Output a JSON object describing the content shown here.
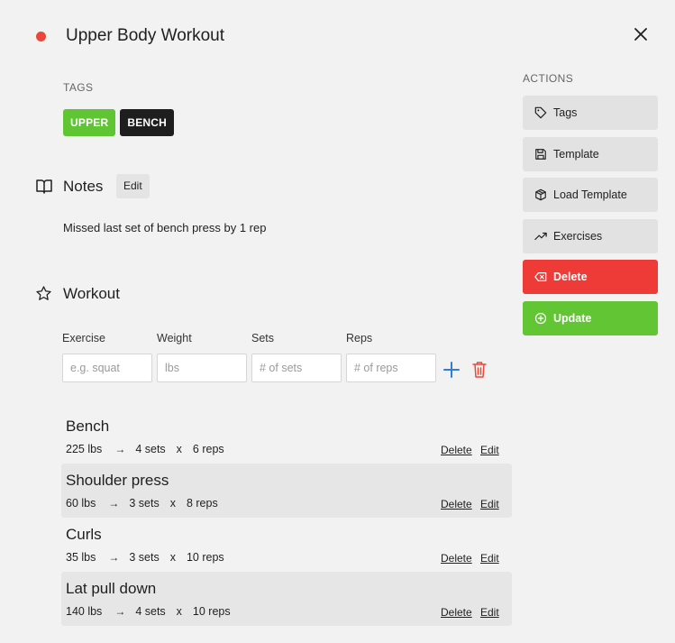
{
  "header": {
    "title": "Upper Body Workout",
    "status_color": "#e8483b"
  },
  "tags": {
    "label": "TAGS",
    "items": [
      {
        "label": "UPPER",
        "color": "#5fc532"
      },
      {
        "label": "BENCH",
        "color": "#1e1e1e"
      }
    ]
  },
  "notes": {
    "heading": "Notes",
    "edit_label": "Edit",
    "text": "Missed last set of bench press by 1 rep",
    "icon": "book-open-icon"
  },
  "workout": {
    "heading": "Workout",
    "icon": "star-icon",
    "form": {
      "exercise_label": "Exercise",
      "exercise_placeholder": "e.g. squat",
      "weight_label": "Weight",
      "weight_placeholder": "lbs",
      "sets_label": "Sets",
      "sets_placeholder": "# of sets",
      "reps_label": "Reps",
      "reps_placeholder": "# of reps"
    },
    "exercises": [
      {
        "name": "Bench",
        "weight": "225 lbs",
        "arrow": "→",
        "sets": "4 sets",
        "x": "x",
        "reps": "6 reps",
        "delete": "Delete",
        "edit": "Edit"
      },
      {
        "name": "Shoulder press",
        "weight": "60 lbs",
        "arrow": "→",
        "sets": "3 sets",
        "x": "x",
        "reps": "8 reps",
        "delete": "Delete",
        "edit": "Edit"
      },
      {
        "name": "Curls",
        "weight": "35 lbs",
        "arrow": "→",
        "sets": "3 sets",
        "x": "x",
        "reps": "10 reps",
        "delete": "Delete",
        "edit": "Edit"
      },
      {
        "name": "Lat pull down",
        "weight": "140 lbs",
        "arrow": "→",
        "sets": "4 sets",
        "x": "x",
        "reps": "10 reps",
        "delete": "Delete",
        "edit": "Edit"
      }
    ]
  },
  "actions": {
    "label": "ACTIONS",
    "items": [
      {
        "label": "Tags",
        "icon": "tag-icon"
      },
      {
        "label": "Template",
        "icon": "save-icon"
      },
      {
        "label": "Load Template",
        "icon": "package-icon"
      },
      {
        "label": "Exercises",
        "icon": "trending-up-icon"
      },
      {
        "label": "Delete",
        "icon": "backspace-icon",
        "color": "#ee3b38"
      },
      {
        "label": "Update",
        "icon": "plus-circle-icon",
        "color": "#62c534"
      }
    ]
  },
  "colors": {
    "background": "#f2f2f2",
    "accent_blue": "#2f7de1",
    "danger_red": "#e8483b"
  }
}
